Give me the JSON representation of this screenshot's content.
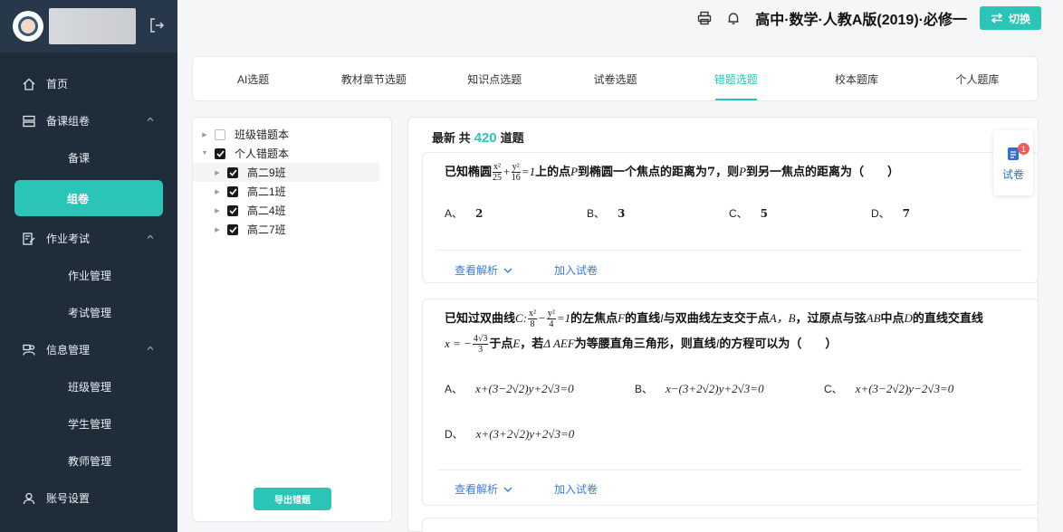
{
  "sidebar": {
    "nav": [
      {
        "label": "首页",
        "icon": "home-icon"
      },
      {
        "label": "备课组卷",
        "icon": "layers-icon"
      },
      {
        "label": "备课"
      },
      {
        "label": "组卷"
      },
      {
        "label": "作业考试",
        "icon": "edit-icon"
      },
      {
        "label": "作业管理"
      },
      {
        "label": "考试管理"
      },
      {
        "label": "信息管理",
        "icon": "users-icon"
      },
      {
        "label": "班级管理"
      },
      {
        "label": "学生管理"
      },
      {
        "label": "教师管理"
      },
      {
        "label": "账号设置",
        "icon": "user-icon"
      }
    ]
  },
  "topbar": {
    "course_title": "高中·数学·人教A版(2019)·必修一",
    "switch_label": "切换"
  },
  "tabs": [
    "AI选题",
    "教材章节选题",
    "知识点选题",
    "试卷选题",
    "错题选题",
    "校本题库",
    "个人题库"
  ],
  "tree": {
    "items": [
      {
        "label": "班级错题本"
      },
      {
        "label": "个人错题本"
      },
      {
        "label": "高二9班"
      },
      {
        "label": "高二1班"
      },
      {
        "label": "高二4班"
      },
      {
        "label": "高二7班"
      }
    ],
    "export_label": "导出错题"
  },
  "summary": {
    "prefix": "最新 共",
    "count": "420",
    "suffix": "道题"
  },
  "questions": [
    {
      "text_a": "已知椭圆",
      "text_b": "上的点",
      "text_c": "到椭圆一个焦点的距离为7，则",
      "text_d": "到另一焦点的距离为（　　）",
      "options": [
        {
          "label": "A、",
          "value": "2"
        },
        {
          "label": "B、",
          "value": "3"
        },
        {
          "label": "C、",
          "value": "5"
        },
        {
          "label": "D、",
          "value": "7"
        }
      ],
      "analysis_label": "查看解析",
      "add_label": "加入试卷"
    },
    {
      "line1_a": "已知过双曲线",
      "line1_b": "的左焦点",
      "line1_c": "的直线",
      "line1_d": "与双曲线左支交于点",
      "line1_e": "，过原点与弦",
      "line1_f": "中点",
      "line1_g": "的直线交直线",
      "line2_a": "于点",
      "line2_b": "，若",
      "line2_c": "为等腰直角三角形，则直线",
      "line2_d": "的方程可以为（　　）",
      "options": [
        {
          "label": "A、",
          "value": "x+(3−2√2)y+2√3=0"
        },
        {
          "label": "B、",
          "value": "x−(3+2√2)y+2√3=0"
        },
        {
          "label": "C、",
          "value": "x+(3−2√2)y−2√3=0"
        },
        {
          "label": "D、",
          "value": "x+(3+2√2)y+2√3=0"
        }
      ],
      "analysis_label": "查看解析",
      "add_label": "加入试卷"
    }
  ],
  "paper_float": {
    "label": "试卷",
    "badge": "1"
  },
  "colors": {
    "accent": "#2bc5b8",
    "sidebar_bg": "#1f2d3a",
    "link": "#3b7ae0",
    "badge": "#f25a5a"
  }
}
